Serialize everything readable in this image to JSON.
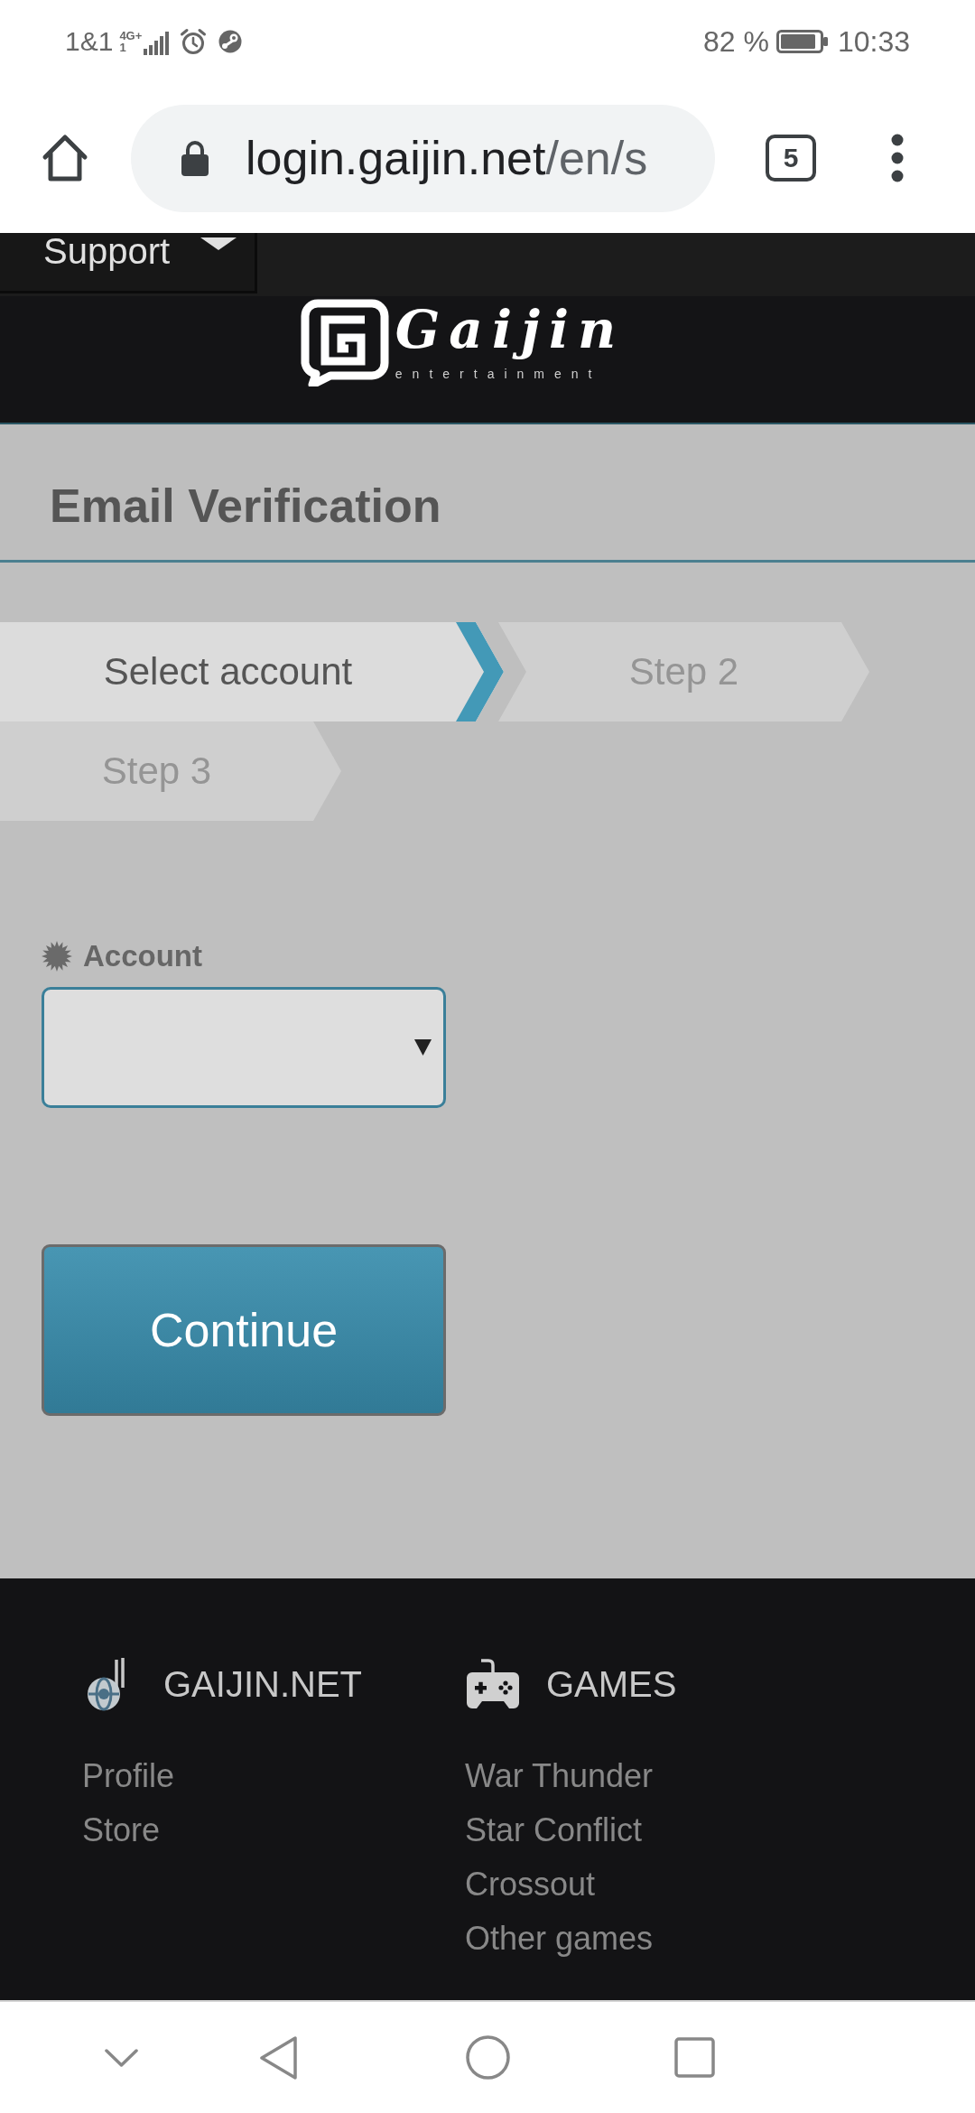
{
  "status_bar": {
    "carrier": "1&1",
    "network": "4G+",
    "sim_slot": "1",
    "battery": "82 %",
    "time": "10:33"
  },
  "browser": {
    "url": {
      "host": "login.gaijin.net",
      "path": "/en/s"
    },
    "tab_count": "5"
  },
  "site_nav": {
    "menu": "Support"
  },
  "logo": {
    "wordmark": "Gaijin",
    "tagline": "entertainment"
  },
  "page_title": "Email Verification",
  "steps": [
    {
      "label": "Select account",
      "selected": true
    },
    {
      "label": "Step 2",
      "selected": false
    },
    {
      "label": "Step 3",
      "selected": false
    }
  ],
  "form": {
    "field": {
      "label": "Account",
      "required": true
    },
    "submit": "Continue"
  },
  "footer": {
    "columns": [
      {
        "kind": "site",
        "title": "GAIJIN.NET",
        "links": [
          "Profile",
          "Store"
        ]
      },
      {
        "kind": "games",
        "title": "GAMES",
        "links": [
          "War Thunder",
          "Star Conflict",
          "Crossout",
          "Other games"
        ]
      }
    ]
  }
}
